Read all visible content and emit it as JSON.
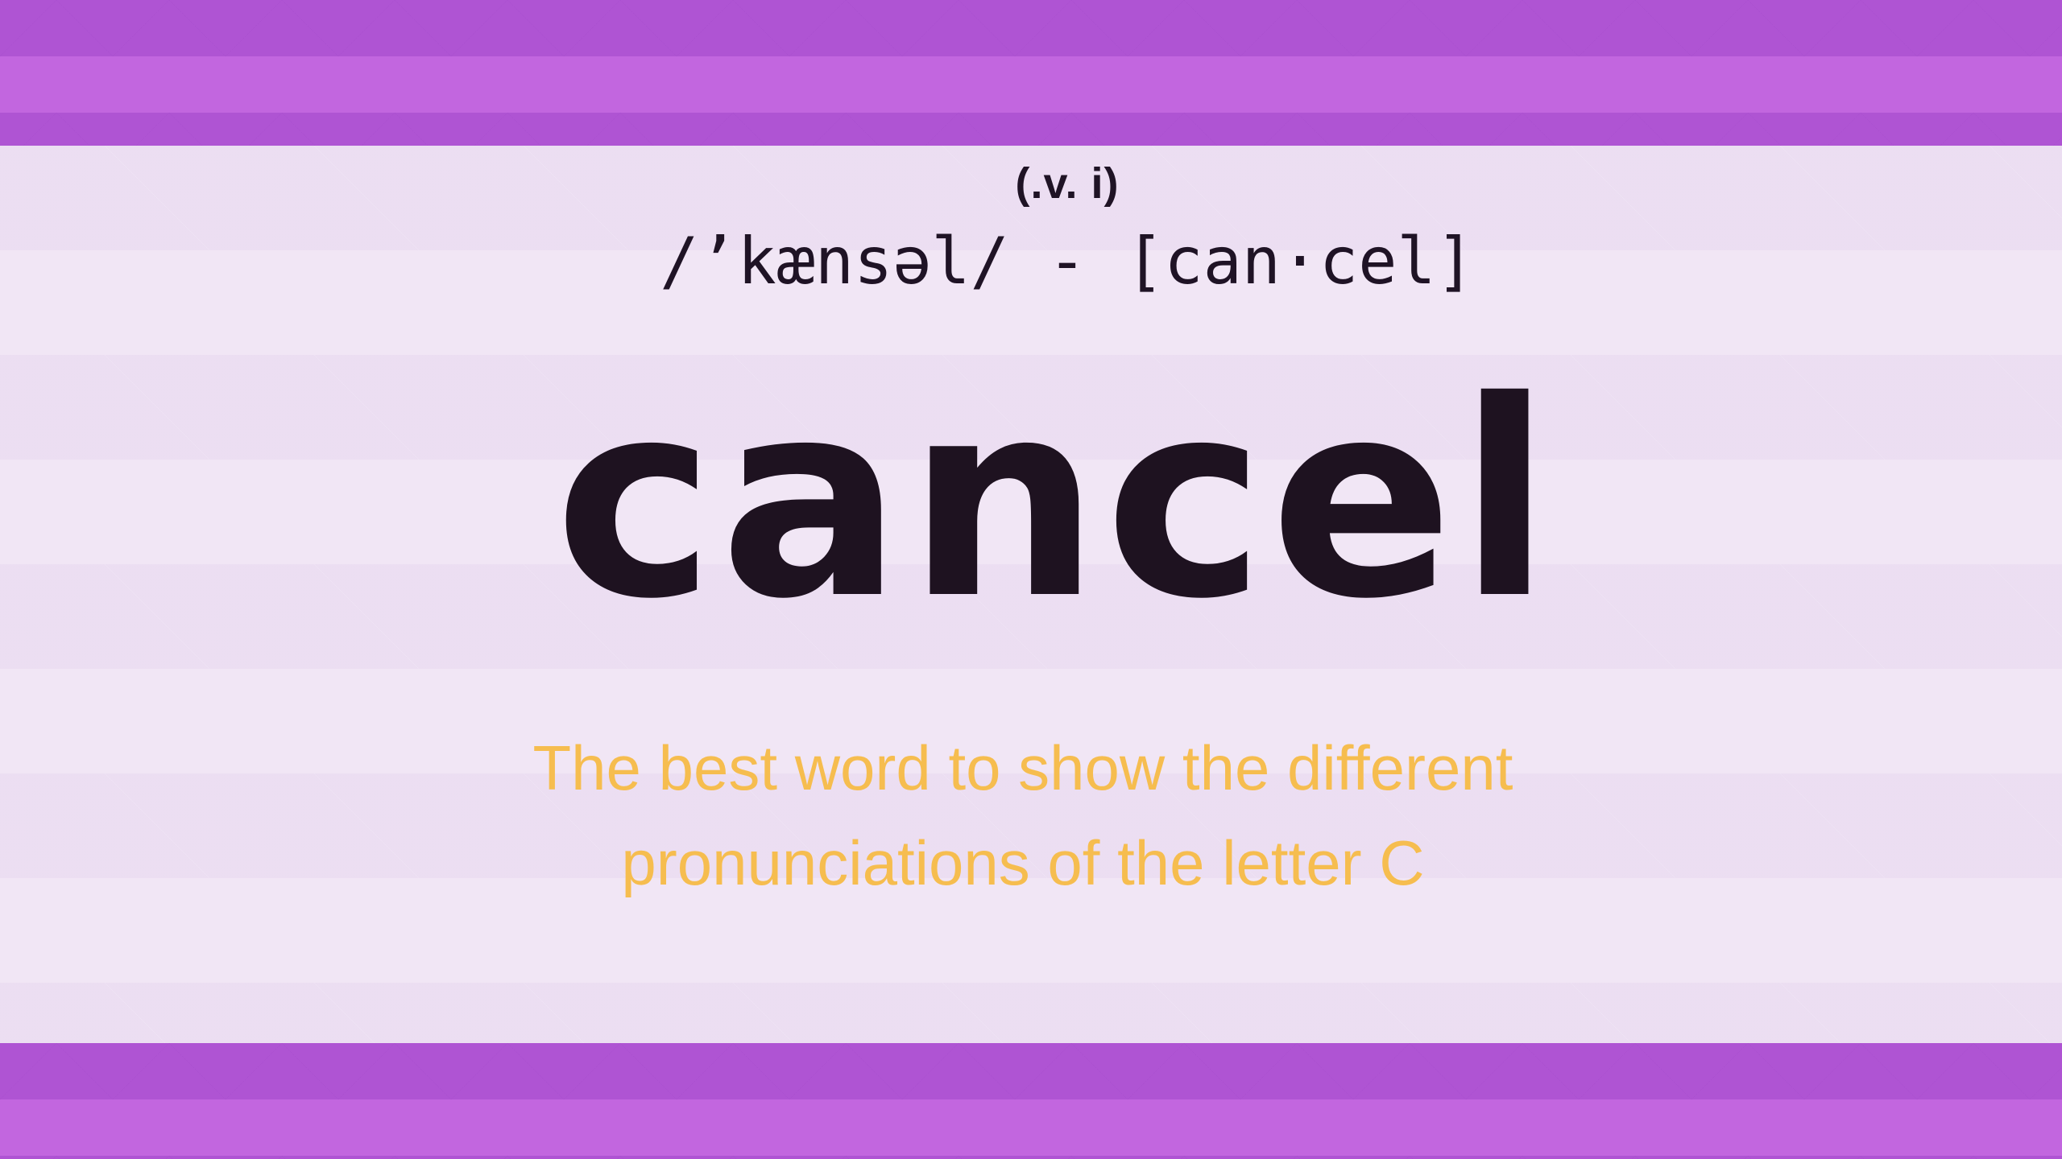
{
  "card": {
    "part_of_speech": "(.v. i)",
    "pronunciation": "/’kænsəl/ - [can·cel]",
    "word": "cancel",
    "tagline_line1": "The best word to show the different",
    "tagline_line2": "pronunciations of the letter C"
  },
  "colors": {
    "band": "#c266df",
    "panel": "#f1e6f5",
    "word": "#1e1220",
    "tagline": "#f6bd4f"
  }
}
